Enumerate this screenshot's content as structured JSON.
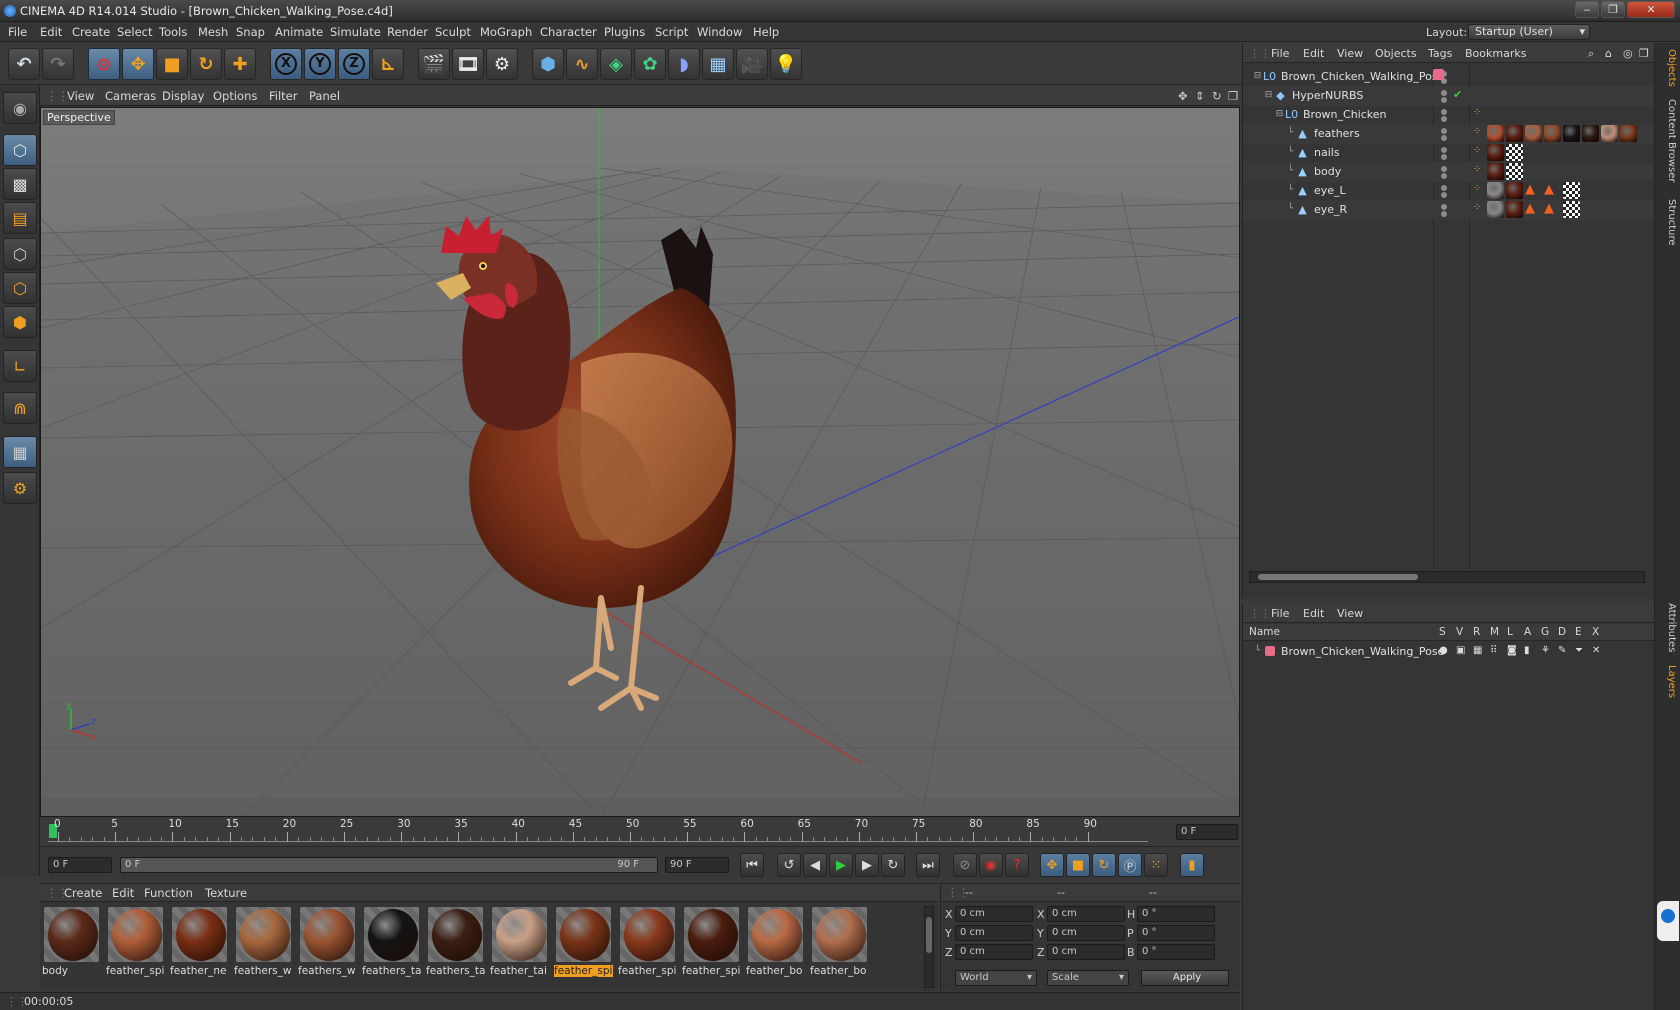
{
  "window": {
    "title": "CINEMA 4D R14.014 Studio - [Brown_Chicken_Walking_Pose.c4d]"
  },
  "menu": [
    "File",
    "Edit",
    "Create",
    "Select",
    "Tools",
    "Mesh",
    "Snap",
    "Animate",
    "Simulate",
    "Render",
    "Sculpt",
    "MoGraph",
    "Character",
    "Plugins",
    "Script",
    "Window",
    "Help"
  ],
  "layout": {
    "label": "Layout:",
    "value": "Startup (User)"
  },
  "toolbar_icons": [
    "undo-icon",
    "redo-icon",
    "live-selection-icon",
    "move-icon",
    "scale-icon",
    "rotate-icon",
    "add-icon",
    "x-axis-icon",
    "y-axis-icon",
    "z-axis-icon",
    "coordinate-system-icon",
    "render-view-icon",
    "render-picture-viewer-icon",
    "render-settings-icon",
    "cube-icon",
    "spline-icon",
    "nurbs-icon",
    "array-icon",
    "deformer-icon",
    "scene-icon",
    "camera-icon",
    "light-icon"
  ],
  "toolbar_glyphs": {
    "x": "X",
    "y": "Y",
    "z": "Z"
  },
  "viewport": {
    "menu": [
      "View",
      "Cameras",
      "Display",
      "Options",
      "Filter",
      "Panel"
    ],
    "label": "Perspective",
    "axis": {
      "y": "y",
      "z": "z",
      "x": "x"
    }
  },
  "timeline": {
    "ticks": [
      "0",
      "5",
      "10",
      "15",
      "20",
      "25",
      "30",
      "35",
      "40",
      "45",
      "50",
      "55",
      "60",
      "65",
      "70",
      "75",
      "80",
      "85",
      "90"
    ],
    "frame_field": "0 F",
    "start_field": "0 F",
    "range_start": "0 F",
    "range_end": "90 F",
    "end_field": "90 F"
  },
  "materials": {
    "menu": [
      "Create",
      "Edit",
      "Function",
      "Texture"
    ],
    "items": [
      {
        "name": "body",
        "color": "#5a2a18",
        "sel": false
      },
      {
        "name": "feather_spi",
        "color": "#b0603a",
        "sel": false
      },
      {
        "name": "feather_ne",
        "color": "#7a2e14",
        "sel": false
      },
      {
        "name": "feathers_w",
        "color": "#a8683e",
        "sel": false
      },
      {
        "name": "feathers_w",
        "color": "#9a5432",
        "sel": false
      },
      {
        "name": "feathers_ta",
        "color": "#141414",
        "sel": false
      },
      {
        "name": "feathers_ta",
        "color": "#3a1e12",
        "sel": false
      },
      {
        "name": "feather_tai",
        "color": "#c8a088",
        "sel": false
      },
      {
        "name": "feather_spi",
        "color": "#7a3418",
        "sel": true
      },
      {
        "name": "feather_spi",
        "color": "#8a3a1c",
        "sel": false
      },
      {
        "name": "feather_spi",
        "color": "#4a1c0e",
        "sel": false
      },
      {
        "name": "feather_bo",
        "color": "#b86a44",
        "sel": false
      },
      {
        "name": "feather_bo",
        "color": "#b06e4e",
        "sel": false
      }
    ]
  },
  "coords": {
    "headers": [
      "--",
      "--",
      "--"
    ],
    "rows": [
      {
        "a": "X",
        "av": "0 cm",
        "b": "X",
        "bv": "0 cm",
        "c": "H",
        "cv": "0 °"
      },
      {
        "a": "Y",
        "av": "0 cm",
        "b": "Y",
        "bv": "0 cm",
        "c": "P",
        "cv": "0 °"
      },
      {
        "a": "Z",
        "av": "0 cm",
        "b": "Z",
        "bv": "0 cm",
        "c": "B",
        "cv": "0 °"
      }
    ],
    "mode1": "World",
    "mode2": "Scale",
    "apply": "Apply"
  },
  "status": {
    "time": "00:00:05"
  },
  "objects": {
    "menu": [
      "File",
      "Edit",
      "View",
      "Objects",
      "Tags",
      "Bookmarks"
    ],
    "rows": [
      {
        "name": "Brown_Chicken_Walking_Pose",
        "indent": 0,
        "icon": "null-object-icon",
        "glyph": "L0"
      },
      {
        "name": "HyperNURBS",
        "indent": 1,
        "icon": "hypernurbs-icon",
        "glyph": "◆"
      },
      {
        "name": "Brown_Chicken",
        "indent": 2,
        "icon": "null-object-icon",
        "glyph": "L0"
      },
      {
        "name": "feathers",
        "indent": 3,
        "icon": "polygon-object-icon",
        "glyph": "▲"
      },
      {
        "name": "nails",
        "indent": 3,
        "icon": "polygon-object-icon",
        "glyph": "▲"
      },
      {
        "name": "body",
        "indent": 3,
        "icon": "polygon-object-icon",
        "glyph": "▲"
      },
      {
        "name": "eye_L",
        "indent": 3,
        "icon": "polygon-object-icon",
        "glyph": "▲"
      },
      {
        "name": "eye_R",
        "indent": 3,
        "icon": "polygon-object-icon",
        "glyph": "▲"
      }
    ],
    "check": "✔"
  },
  "layers": {
    "menu": [
      "File",
      "Edit",
      "View"
    ],
    "header": {
      "name": "Name",
      "flags": [
        "S",
        "V",
        "R",
        "M",
        "L",
        "A",
        "G",
        "D",
        "E",
        "X"
      ]
    },
    "rows": [
      {
        "name": "Brown_Chicken_Walking_Pose",
        "color": "#e86a8a"
      }
    ]
  },
  "right_tabs": [
    "Objects",
    "Content Browser",
    "Structure",
    "Attributes",
    "Layers"
  ],
  "colors": {
    "accent": "#f0a020",
    "selection": "#3d5e80",
    "x_axis": "#c03030",
    "y_axis": "#30c030",
    "z_axis": "#3040c0"
  }
}
